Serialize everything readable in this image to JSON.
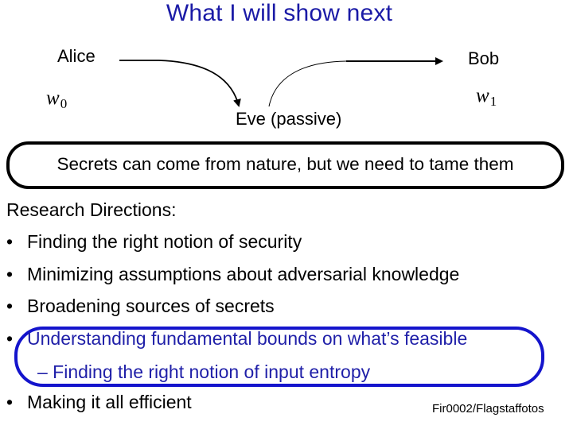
{
  "title": "What I will show next",
  "diagram": {
    "alice": "Alice",
    "bob": "Bob",
    "eve": "Eve (passive)",
    "w0": {
      "base": "w",
      "sub": "0"
    },
    "w1": {
      "base": "w",
      "sub": "1"
    }
  },
  "callout": "Secrets can come from nature, but we need to tame them",
  "research": {
    "heading": "Research Directions:",
    "bullet_glyph": "•",
    "items": [
      "Finding the right notion of security",
      "Minimizing assumptions about adversarial knowledge",
      "Broadening sources of secrets",
      "Understanding fundamental bounds on what’s feasible",
      "Making it all efficient"
    ],
    "sub_item": "– Finding the right notion of input entropy"
  },
  "credit": "Fir0002/Flagstaffotos",
  "colors": {
    "title": "#1a1aa6",
    "highlight_text": "#1f1fa8",
    "highlight_border": "#1414cc",
    "callout_border": "#000000"
  }
}
